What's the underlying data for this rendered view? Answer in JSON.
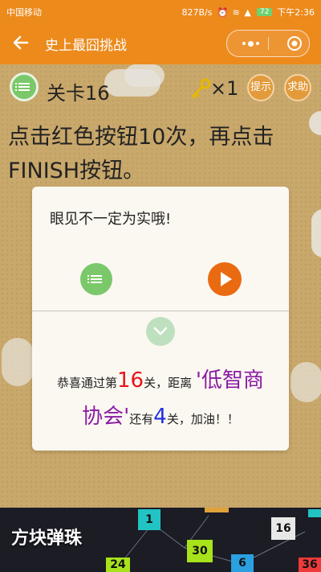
{
  "status": {
    "carrier": "中国移动",
    "speed": "827B/s",
    "battery": "72",
    "time": "下午2:36"
  },
  "nav": {
    "title": "史上最囧挑战"
  },
  "game": {
    "level_label": "关卡16",
    "key_count": "×1",
    "hint_button": "提示",
    "help_button": "求助",
    "instruction_line1": "点击红色按钮10次，再点击",
    "instruction_line2": "FINISH按钮。"
  },
  "modal": {
    "hint": "眼见不一定为实哦!",
    "congrats": {
      "p1": "恭喜通过第",
      "level": "16",
      "p2": "关，距离 ",
      "club": "'低智商",
      "club2": "协会'",
      "p3": "还有",
      "remaining": "4",
      "p4": "关，加油！！"
    }
  },
  "banner": {
    "title": "方块弹珠",
    "tiles": [
      "1",
      "16",
      "30",
      "6",
      "24",
      "36"
    ]
  },
  "colors": {
    "accent": "#ec8a1c",
    "list_button": "#7bc86a",
    "play_button": "#ea6a12"
  }
}
